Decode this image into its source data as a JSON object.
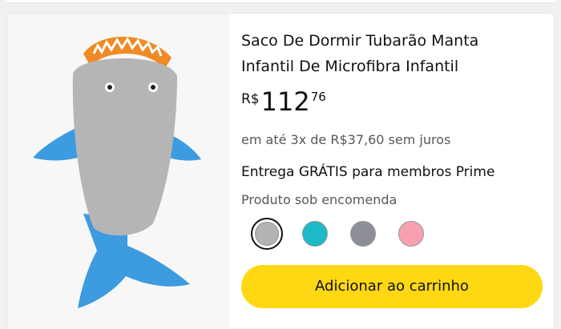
{
  "product": {
    "title": "Saco De Dormir Tubarão Manta\nInfantil De Microfibra Infantil",
    "image_alt": "shark-sleeping-bag-image",
    "price": {
      "currency": "R$",
      "whole": "112",
      "fraction": "76"
    },
    "installments": "em até 3x de R$37,60 sem juros",
    "delivery": "Entrega GRÁTIS para membros Prime",
    "availability": "Produto sob encomenda",
    "colors": [
      {
        "name": "color-gray",
        "hex": "#b3b3b3",
        "selected": true
      },
      {
        "name": "color-teal",
        "hex": "#1fb8c6",
        "selected": false
      },
      {
        "name": "color-dark-gray",
        "hex": "#8e8f96",
        "selected": false
      },
      {
        "name": "color-pink",
        "hex": "#f7a1b0",
        "selected": false
      }
    ],
    "add_to_cart_label": "Adicionar ao carrinho"
  },
  "theme": {
    "button_color": "#ffd814",
    "shark_body": "#b5b5b5",
    "shark_fins": "#3d9be0",
    "shark_mouth": "#f08a24"
  }
}
